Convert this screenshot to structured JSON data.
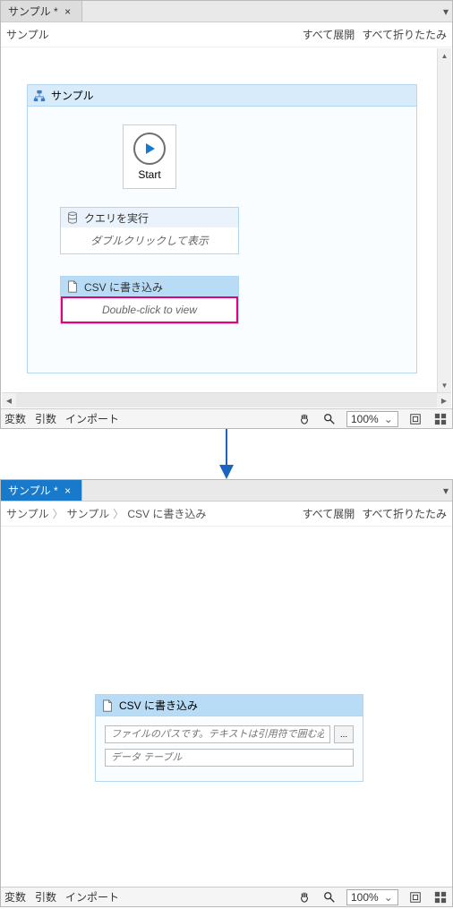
{
  "panel1": {
    "tab": {
      "label": "サンプル *",
      "close": "×"
    },
    "title": "サンプル",
    "links": {
      "expand": "すべて展開",
      "collapse": "すべて折りたたみ"
    },
    "flow": {
      "title": "サンプル",
      "start_label": "Start",
      "activity1": {
        "title": "クエリを実行",
        "body": "ダブルクリックして表示"
      },
      "activity2": {
        "title": "CSV に書き込み",
        "body": "Double-click to view"
      }
    },
    "bottom": {
      "vars": "変数",
      "args": "引数",
      "imports": "インポート",
      "zoom": "100%",
      "zoom_drop": "⌄"
    }
  },
  "panel2": {
    "tab": {
      "label": "サンプル *",
      "close": "×"
    },
    "breadcrumb": [
      "サンプル",
      "サンプル",
      "CSV に書き込み"
    ],
    "links": {
      "expand": "すべて展開",
      "collapse": "すべて折りたたみ"
    },
    "activity": {
      "title": "CSV に書き込み",
      "input1_placeholder": "ファイルのパスです。テキストは引用符で囲む必要があります",
      "dots": "...",
      "input2_placeholder": "データ テーブル"
    },
    "bottom": {
      "vars": "変数",
      "args": "引数",
      "imports": "インポート",
      "zoom": "100%",
      "zoom_drop": "⌄"
    }
  }
}
